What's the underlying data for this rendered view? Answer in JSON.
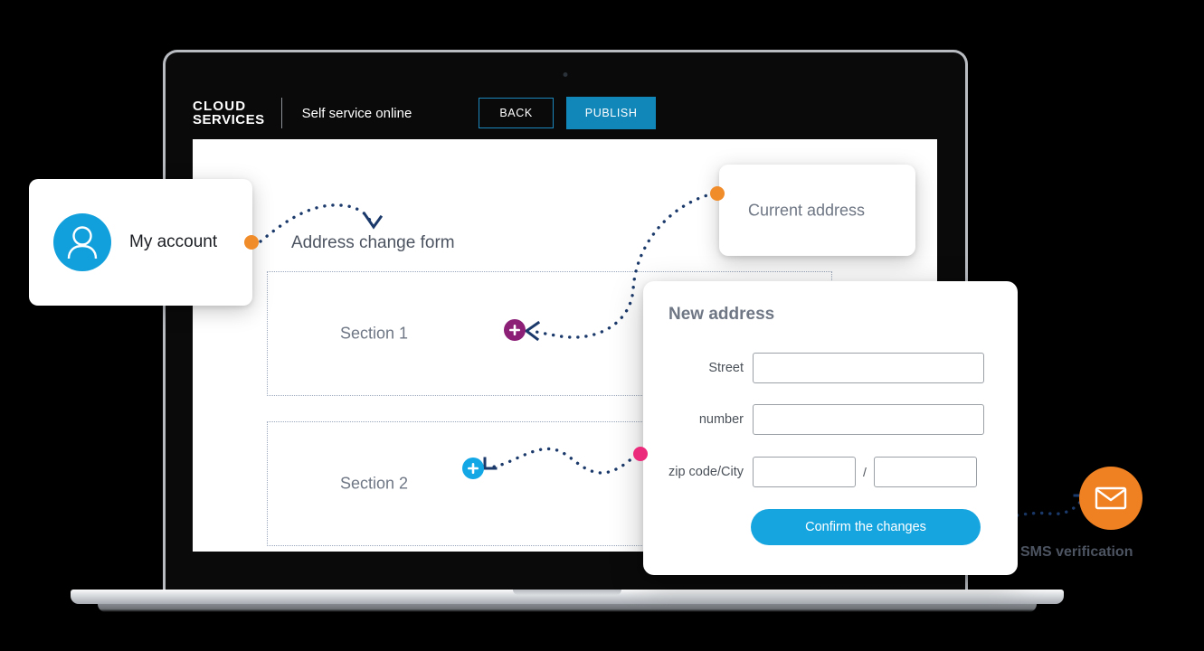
{
  "brand": {
    "line1": "CLOUD",
    "line2": "SERVICES",
    "tagline": "Self service online",
    "accent_blue": "#1186b8"
  },
  "topbar": {
    "back_label": "BACK",
    "publish_label": "PUBLISH"
  },
  "screen": {
    "form_title": "Address change form",
    "sections": [
      {
        "label": "Section 1"
      },
      {
        "label": "Section 2"
      }
    ]
  },
  "cards": {
    "account": {
      "label": "My account",
      "icon": "user-avatar-icon",
      "avatar_color": "#12a0dc"
    },
    "current_address": {
      "title": "Current address"
    },
    "new_address": {
      "title": "New address",
      "fields": [
        {
          "label": "Street",
          "value": "",
          "placeholder": ""
        },
        {
          "label": "number",
          "value": "",
          "placeholder": ""
        },
        {
          "label": "zip code/City",
          "value": "",
          "placeholder": "",
          "separator": "/",
          "value2": "",
          "placeholder2": ""
        }
      ],
      "confirm_label": "Confirm the changes",
      "confirm_color": "#17a5e0"
    }
  },
  "sms": {
    "label": "SMS verification",
    "icon": "envelope-icon",
    "circle_color": "#f08122"
  },
  "markers": {
    "orange": "#f18c2a",
    "pink": "#ec2a7b",
    "purple_badge": "#8c1f76",
    "blue_badge": "#13a7e6",
    "connector_line": "#1b3a6b"
  }
}
